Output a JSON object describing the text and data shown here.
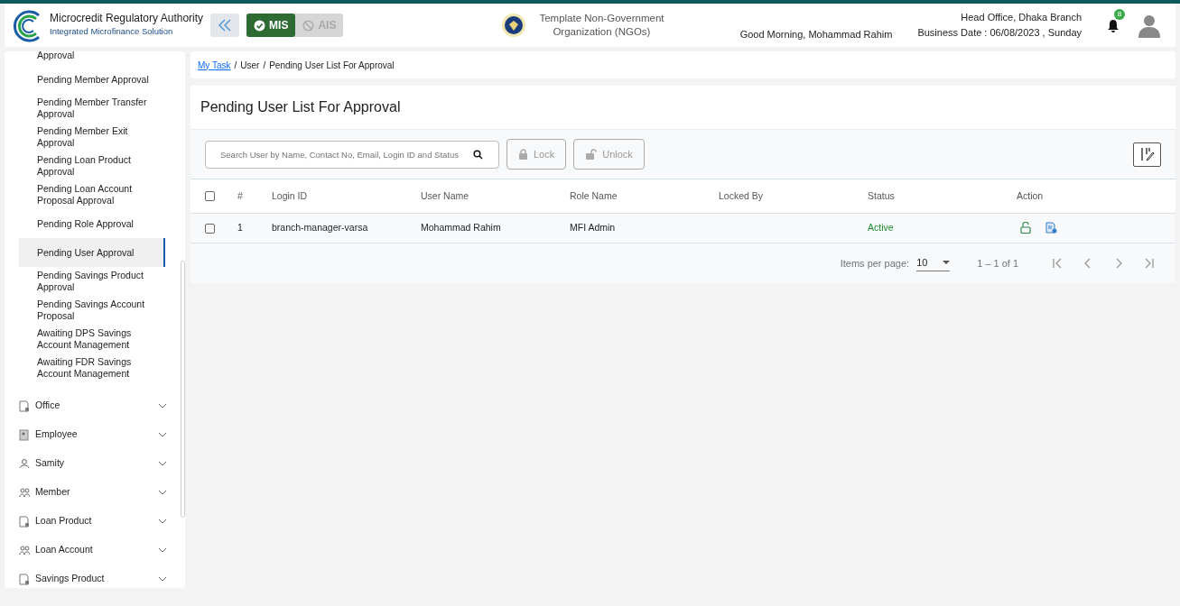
{
  "header": {
    "org_name": "Microcredit Regulatory Authority",
    "org_subtitle": "Integrated Microfinance Solution",
    "modules": [
      {
        "label": "MIS",
        "selected": true
      },
      {
        "label": "AIS",
        "selected": false
      }
    ],
    "organization": "Template Non-Government Organization (NGOs)",
    "greeting": "Good Morning, Mohammad Rahim",
    "office": "Head Office, Dhaka Branch",
    "business_date": "Business Date : 06/08/2023 , Sunday",
    "notification_count": "8"
  },
  "sidebar": {
    "sub_items": [
      {
        "label": "Approval",
        "selected": false
      },
      {
        "label": "Pending Member Approval",
        "selected": false
      },
      {
        "label": "Pending Member Transfer Approval",
        "selected": false
      },
      {
        "label": "Pending Member Exit Approval",
        "selected": false
      },
      {
        "label": "Pending Loan Product Approval",
        "selected": false
      },
      {
        "label": "Pending Loan Account Proposal Approval",
        "selected": false
      },
      {
        "label": "Pending Role Approval",
        "selected": false
      },
      {
        "label": "Pending User Approval",
        "selected": true
      },
      {
        "label": "Pending Savings Product Approval",
        "selected": false
      },
      {
        "label": "Pending Savings Account Proposal",
        "selected": false
      },
      {
        "label": "Awaiting DPS Savings Account Management",
        "selected": false
      },
      {
        "label": "Awaiting FDR Savings Account Management",
        "selected": false
      }
    ],
    "groups": [
      {
        "label": "Office",
        "kind": "doc",
        "expanded": false
      },
      {
        "label": "Employee",
        "kind": "badge",
        "expanded": false
      },
      {
        "label": "Samity",
        "kind": "people",
        "expanded": false
      },
      {
        "label": "Member",
        "kind": "group",
        "expanded": false
      },
      {
        "label": "Loan Product",
        "kind": "doc",
        "expanded": false
      },
      {
        "label": "Loan Account",
        "kind": "group",
        "expanded": false
      },
      {
        "label": "Savings Product",
        "kind": "doc",
        "expanded": false
      }
    ]
  },
  "breadcrumb": {
    "separator": "/",
    "items": [
      "My Task",
      "User",
      "Pending User List For Approval"
    ]
  },
  "page_title": "Pending User List For Approval",
  "search": {
    "placeholder": "Search User by Name, Contact No, Email, Login ID and Status"
  },
  "toolbar_buttons": [
    {
      "label": "Lock",
      "kind": "lock",
      "disabled": true
    },
    {
      "label": "Unlock",
      "kind": "unlock",
      "disabled": true
    }
  ],
  "table": {
    "select_all_checked": false,
    "columns": [
      "#",
      "Login ID",
      "User Name",
      "Role Name",
      "Locked By",
      "Status",
      "Action"
    ],
    "rows": [
      {
        "checked": false,
        "number": "1",
        "login_id": "branch-manager-varsa",
        "user_name": "Mohammad Rahim",
        "role_name": "MFI Admin",
        "status": "Active"
      }
    ]
  },
  "paginator": {
    "label": "Items per page:",
    "page_size": "10",
    "range": "1 – 1 of 1",
    "buttons": [
      {
        "kind": "first",
        "disabled": true
      },
      {
        "kind": "prev",
        "disabled": true
      },
      {
        "kind": "next",
        "disabled": true
      },
      {
        "kind": "last",
        "disabled": true
      }
    ]
  }
}
